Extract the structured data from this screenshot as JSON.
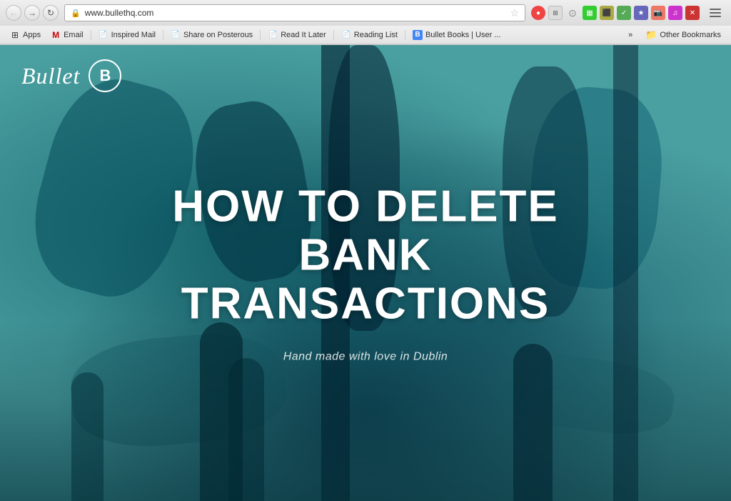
{
  "browser": {
    "url": "www.bullethq.com",
    "back_title": "←",
    "forward_title": "→",
    "refresh_title": "↻",
    "star_title": "★"
  },
  "bookmarks": {
    "items": [
      {
        "id": "apps",
        "label": "Apps",
        "icon": "apps-icon",
        "has_icon": true
      },
      {
        "id": "email",
        "label": "Email",
        "icon": "email-icon",
        "has_icon": true
      },
      {
        "id": "inspired-mail",
        "label": "Inspired Mail",
        "icon": "page-icon",
        "has_icon": true
      },
      {
        "id": "share-on-posterous",
        "label": "Share on Posterous",
        "icon": "page-icon",
        "has_icon": true
      },
      {
        "id": "read-it-later",
        "label": "Read It Later",
        "icon": "page-icon",
        "has_icon": true
      },
      {
        "id": "reading-list",
        "label": "Reading List",
        "icon": "page-icon",
        "has_icon": true
      },
      {
        "id": "bullet-books",
        "label": "Bullet Books | User ...",
        "icon": "bullet-icon",
        "has_icon": true
      }
    ],
    "more_label": "»",
    "other_bookmarks_label": "Other Bookmarks"
  },
  "website": {
    "logo_text": "Bullet",
    "logo_letter": "B",
    "hero_title": "HOW TO DELETE BANK TRANSACTIONS",
    "hero_subtitle": "Hand made with love in Dublin"
  }
}
